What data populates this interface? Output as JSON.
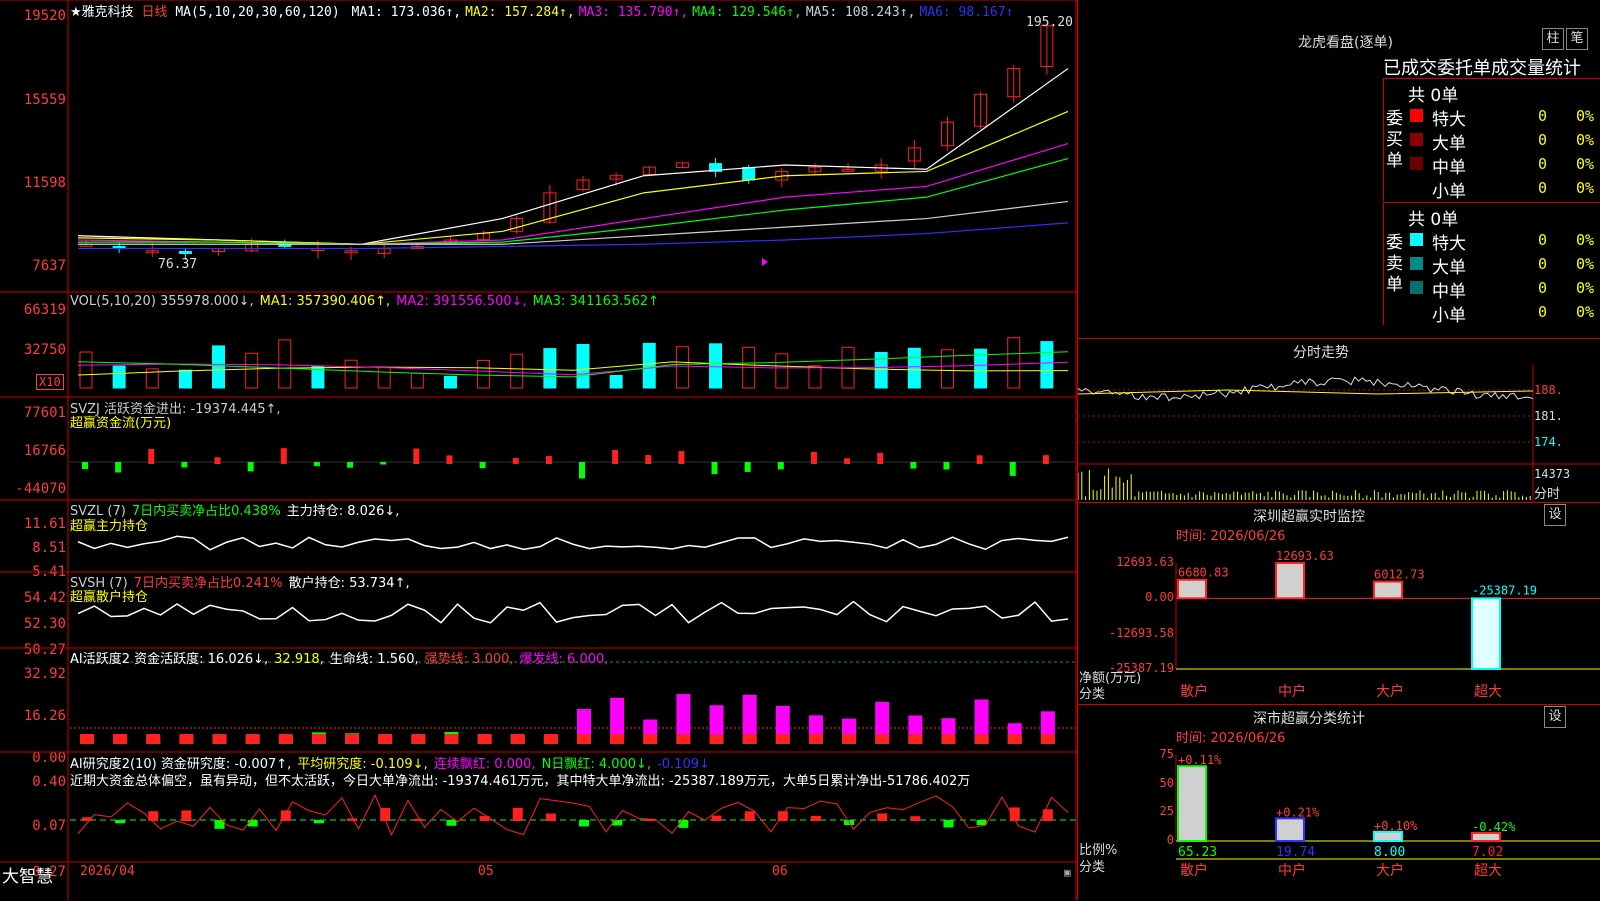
{
  "app": {
    "brand": "大智慧"
  },
  "main_chart": {
    "stock_name": "★雅克科技",
    "period": "日线",
    "ma_label": "MA(5,10,20,30,60,120)",
    "ma": [
      {
        "label": "MA1: 173.036↑,",
        "color": "#ffffff"
      },
      {
        "label": "MA2: 157.284↑,",
        "color": "#ffff00"
      },
      {
        "label": "MA3: 135.790↑,",
        "color": "#ff00ff"
      },
      {
        "label": "MA4: 129.546↑,",
        "color": "#00ff00"
      },
      {
        "label": "MA5: 108.243↑,",
        "color": "#d0d0d0"
      },
      {
        "label": "MA6: 98.167↑",
        "color": "#3030ff"
      }
    ],
    "y_labels": [
      "19520",
      "15559",
      "11598",
      "7637"
    ],
    "high_label": "195.20",
    "low_label": "76.37"
  },
  "vol_panel": {
    "header": [
      {
        "text": "VOL(5,10,20) 355978.000↓,",
        "color": "#cccccc"
      },
      {
        "text": "MA1: 357390.406↑,",
        "color": "#ffff00"
      },
      {
        "text": "MA2: 391556.500↓,",
        "color": "#ff00ff"
      },
      {
        "text": "MA3: 341163.562↑",
        "color": "#00ff00"
      }
    ],
    "y_labels": [
      "66319",
      "32750"
    ],
    "unit": "X10"
  },
  "svzj_panel": {
    "header": [
      {
        "text": "SVZJ  活跃资金进出: -19374.445↑,",
        "color": "#cccccc"
      }
    ],
    "subtitle": "超赢资金流(万元)",
    "y_labels": [
      "77601",
      "16766",
      "-44070"
    ]
  },
  "svzl_panel": {
    "header": [
      {
        "text": "SVZL (7)",
        "color": "#cccccc"
      },
      {
        "text": "7日内买卖净占比0.438%",
        "color": "#00ff00"
      },
      {
        "text": "主力持仓: 8.026↓,",
        "color": "#ffffff"
      }
    ],
    "subtitle": "超赢主力持仓",
    "y_labels": [
      "11.61",
      "8.51",
      "5.41"
    ]
  },
  "svsh_panel": {
    "header": [
      {
        "text": "SVSH (7)",
        "color": "#cccccc"
      },
      {
        "text": "7日内买卖净占比0.241%",
        "color": "#ff3b3b"
      },
      {
        "text": "散户持仓: 53.734↑,",
        "color": "#ffffff"
      }
    ],
    "subtitle": "超赢散户持仓",
    "y_labels": [
      "54.42",
      "52.30",
      "50.27"
    ]
  },
  "ai_active_panel": {
    "header": [
      {
        "text": "AI活跃度2 资金活跃度: 16.026↓,",
        "color": "#ffffff"
      },
      {
        "text": "32.918,",
        "color": "#ffff00"
      },
      {
        "text": "生命线: 1.560,",
        "color": "#ffffff"
      },
      {
        "text": "强势线: 3.000,",
        "color": "#ff3b3b"
      },
      {
        "text": "爆发线: 6.000,",
        "color": "#ff00ff"
      }
    ],
    "y_labels": [
      "32.92",
      "16.26",
      "0.00"
    ]
  },
  "ai_research_panel": {
    "header": [
      {
        "text": "AI研究度2(10) 资金研究度: -0.007↑,",
        "color": "#ffffff"
      },
      {
        "text": "平均研究度: -0.109↓,",
        "color": "#ffff00"
      },
      {
        "text": "连续飘红: 0.000,",
        "color": "#ff00ff"
      },
      {
        "text": "N日飘红: 4.000↓,",
        "color": "#00ff00"
      },
      {
        "text": "-0.109↓",
        "color": "#3030ff"
      }
    ],
    "comment": "近期大资金总体偏空，虽有异动，但不太活跃，今日大单净流出: -19374.461万元，其中特大单净流出: -25387.189万元，大单5日累计净出-51786.402万",
    "y_labels": [
      "0.40",
      "0.07",
      "-0.27"
    ]
  },
  "x_axis": {
    "labels": [
      "2026/04",
      "05",
      "06"
    ]
  },
  "dragon": {
    "title": "龙虎看盘(逐单)",
    "btn_bar": "柱",
    "btn_pen": "笔",
    "headline": "已成交委托单成交量统计",
    "buy": {
      "side": "委买单",
      "total": "共 0单",
      "rows": [
        {
          "label": "特大",
          "count": "0",
          "pct": "0%",
          "color": "#ff0000"
        },
        {
          "label": "大单",
          "count": "0",
          "pct": "0%",
          "color": "#8b0000"
        },
        {
          "label": "中单",
          "count": "0",
          "pct": "0%",
          "color": "#6b0000"
        },
        {
          "label": "小单",
          "count": "0",
          "pct": "0%",
          "color": ""
        }
      ]
    },
    "sell": {
      "side": "委卖单",
      "total": "共 0单",
      "rows": [
        {
          "label": "特大",
          "count": "0",
          "pct": "0%",
          "color": "#00ffff"
        },
        {
          "label": "大单",
          "count": "0",
          "pct": "0%",
          "color": "#008b8b"
        },
        {
          "label": "中单",
          "count": "0",
          "pct": "0%",
          "color": "#007070"
        },
        {
          "label": "小单",
          "count": "0",
          "pct": "0%",
          "color": ""
        }
      ]
    }
  },
  "intraday": {
    "title": "分时走势",
    "y_labels": [
      "188.",
      "181.",
      "174."
    ],
    "vol_label": "14373",
    "footer": "分时"
  },
  "monitor": {
    "title": "深圳超赢实时监控",
    "btn": "设",
    "time": "时间: 2026/06/26",
    "y_labels": [
      "12693.63",
      "0.00",
      "-12693.58",
      "-25387.19"
    ],
    "axis_note": "净额(万元)",
    "axis_note2": "分类",
    "chart_data": {
      "type": "bar",
      "categories": [
        "散户",
        "中户",
        "大户",
        "超大"
      ],
      "values": [
        6680.83,
        12693.63,
        6012.73,
        -25387.19
      ],
      "ylim": [
        -25387.19,
        12693.63
      ]
    }
  },
  "classify": {
    "title": "深市超赢分类统计",
    "btn": "设",
    "time": "时间: 2026/06/26",
    "y_labels": [
      "75",
      "50",
      "25",
      "0"
    ],
    "axis_note": "比例%",
    "axis_note2": "分类",
    "chart_data": {
      "type": "bar",
      "categories": [
        "散户",
        "中户",
        "大户",
        "超大"
      ],
      "values": [
        65.23,
        19.74,
        8.0,
        7.02
      ],
      "changes": [
        "+0.11%",
        "+0.21%",
        "+0.10%",
        "-0.42%"
      ],
      "ylim": [
        0,
        75
      ]
    }
  }
}
